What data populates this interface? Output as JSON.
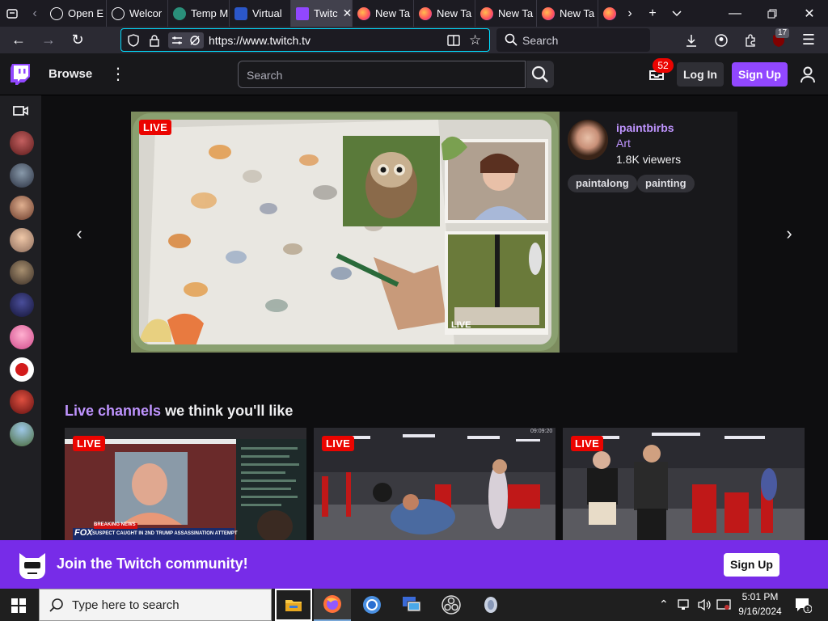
{
  "browser": {
    "tabs": [
      {
        "label": "Open E",
        "icon": "tab-list-icon"
      },
      {
        "label": "Welcor",
        "icon": "github-icon"
      },
      {
        "label": "Temp M",
        "icon": "globe-icon"
      },
      {
        "label": "Virtual",
        "icon": "virtual-icon"
      },
      {
        "label": "Twitc",
        "icon": "twitch-icon",
        "active": true
      },
      {
        "label": "New Ta",
        "icon": "firefox-icon"
      },
      {
        "label": "New Ta",
        "icon": "firefox-icon"
      },
      {
        "label": "New Ta",
        "icon": "firefox-icon"
      },
      {
        "label": "New Ta",
        "icon": "firefox-icon"
      }
    ],
    "url": "https://www.twitch.tv",
    "search_placeholder": "Search",
    "extensions_badge": "17"
  },
  "twitch": {
    "browse_label": "Browse",
    "search_placeholder": "Search",
    "inbox_count": "52",
    "login_label": "Log In",
    "signup_label": "Sign Up",
    "featured": {
      "live_label": "LIVE",
      "channel": "ipaintbirbs",
      "category": "Art",
      "viewers": "1.8K viewers",
      "tags": [
        "paintalong",
        "painting"
      ],
      "overlay_live": "LIVE"
    },
    "section": {
      "title_accent": "Live channels",
      "title_rest": " we think you'll like"
    },
    "cards": [
      {
        "live_label": "LIVE",
        "ticker": "SUSPECT CAUGHT IN 2ND TRUMP ASSASSINATION ATTEMPT",
        "breaking": "BREAKING NEWS",
        "network": "FOX"
      },
      {
        "live_label": "LIVE",
        "timestamp": "09:09:20"
      },
      {
        "live_label": "LIVE"
      }
    ],
    "join_banner": {
      "text": "Join the Twitch community!",
      "signup_label": "Sign Up"
    }
  },
  "taskbar": {
    "search_placeholder": "Type here to search",
    "time": "5:01 PM",
    "date": "9/16/2024"
  },
  "colors": {
    "twitch_purple": "#9147ff",
    "accent_purple": "#bf94ff",
    "live_red": "#eb0400",
    "banner_purple": "#772ce8"
  }
}
